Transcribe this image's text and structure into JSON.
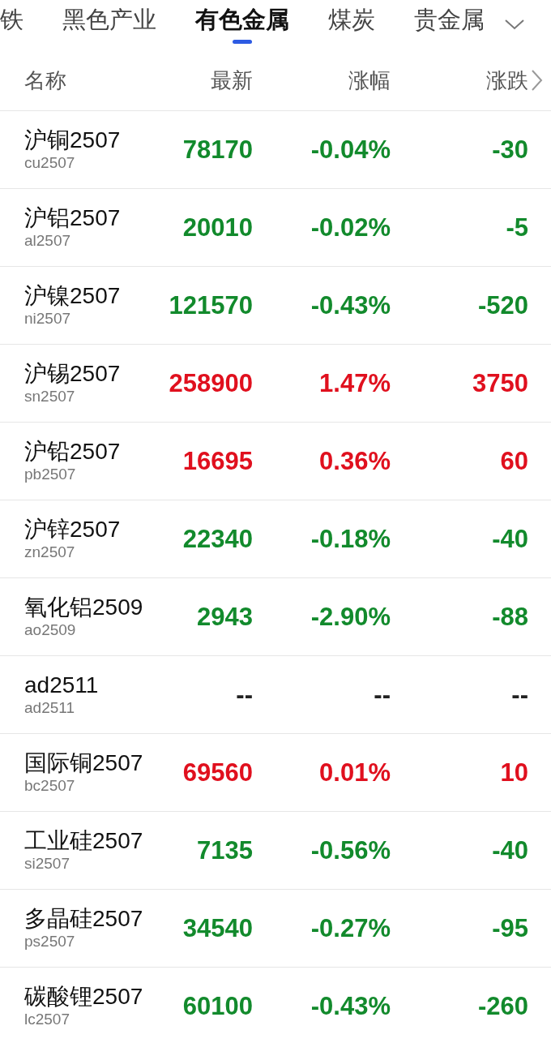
{
  "tabs": [
    {
      "label": "铁",
      "selected": false
    },
    {
      "label": "黑色产业",
      "selected": false
    },
    {
      "label": "有色金属",
      "selected": true
    },
    {
      "label": "煤炭",
      "selected": false
    },
    {
      "label": "贵金属",
      "selected": false
    }
  ],
  "columns": [
    "名称",
    "最新",
    "涨幅",
    "涨跌"
  ],
  "rows": [
    {
      "name": "沪铜2507",
      "code": "cu2507",
      "latest": "78170",
      "pct": "-0.04%",
      "change": "-30",
      "color": "#128a2c"
    },
    {
      "name": "沪铝2507",
      "code": "al2507",
      "latest": "20010",
      "pct": "-0.02%",
      "change": "-5",
      "color": "#128a2c"
    },
    {
      "name": "沪镍2507",
      "code": "ni2507",
      "latest": "121570",
      "pct": "-0.43%",
      "change": "-520",
      "color": "#128a2c"
    },
    {
      "name": "沪锡2507",
      "code": "sn2507",
      "latest": "258900",
      "pct": "1.47%",
      "change": "3750",
      "color": "#e0101e"
    },
    {
      "name": "沪铅2507",
      "code": "pb2507",
      "latest": "16695",
      "pct": "0.36%",
      "change": "60",
      "color": "#e0101e"
    },
    {
      "name": "沪锌2507",
      "code": "zn2507",
      "latest": "22340",
      "pct": "-0.18%",
      "change": "-40",
      "color": "#128a2c"
    },
    {
      "name": "氧化铝2509",
      "code": "ao2509",
      "latest": "2943",
      "pct": "-2.90%",
      "change": "-88",
      "color": "#128a2c"
    },
    {
      "name": "ad2511",
      "code": "ad2511",
      "latest": "--",
      "pct": "--",
      "change": "--",
      "color": "#222222"
    },
    {
      "name": "国际铜2507",
      "code": "bc2507",
      "latest": "69560",
      "pct": "0.01%",
      "change": "10",
      "color": "#e0101e"
    },
    {
      "name": "工业硅2507",
      "code": "si2507",
      "latest": "7135",
      "pct": "-0.56%",
      "change": "-40",
      "color": "#128a2c"
    },
    {
      "name": "多晶硅2507",
      "code": "ps2507",
      "latest": "34540",
      "pct": "-0.27%",
      "change": "-95",
      "color": "#128a2c"
    },
    {
      "name": "碳酸锂2507",
      "code": "lc2507",
      "latest": "60100",
      "pct": "-0.43%",
      "change": "-260",
      "color": "#128a2c"
    }
  ]
}
